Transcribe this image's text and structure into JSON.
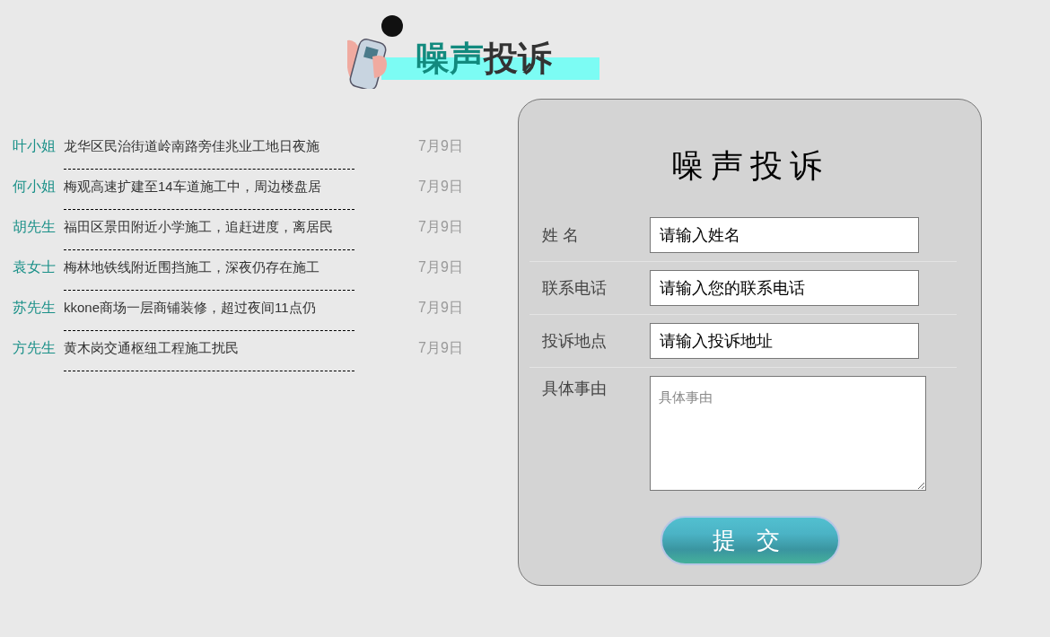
{
  "logo": {
    "title": "噪声投诉"
  },
  "complaints": [
    {
      "name": "叶小姐",
      "summary": "龙华区民治街道岭南路旁佳兆业工地日夜施",
      "date": "7月9日"
    },
    {
      "name": "何小姐",
      "summary": "梅观高速扩建至14车道施工中，周边楼盘居",
      "date": "7月9日"
    },
    {
      "name": "胡先生",
      "summary": "福田区景田附近小学施工，追赶进度，离居民",
      "date": "7月9日"
    },
    {
      "name": "袁女士",
      "summary": "梅林地铁线附近围挡施工，深夜仍存在施工",
      "date": "7月9日"
    },
    {
      "name": "苏先生",
      "summary": "kkone商场一层商铺装修，超过夜间11点仍",
      "date": "7月9日"
    },
    {
      "name": "方先生",
      "summary": "黄木岗交通枢纽工程施工扰民",
      "date": "7月9日"
    }
  ],
  "form": {
    "title": "噪声投诉",
    "fields": [
      {
        "kind": "input",
        "label": "姓 名",
        "value": "请输入姓名"
      },
      {
        "kind": "input",
        "label": "联系电话",
        "value": "请输入您的联系电话"
      },
      {
        "kind": "input",
        "label": "投诉地点",
        "value": "请输入投诉地址"
      },
      {
        "kind": "textarea",
        "label": "具体事由",
        "placeholder": "具体事由"
      }
    ],
    "submit": "提 交"
  }
}
